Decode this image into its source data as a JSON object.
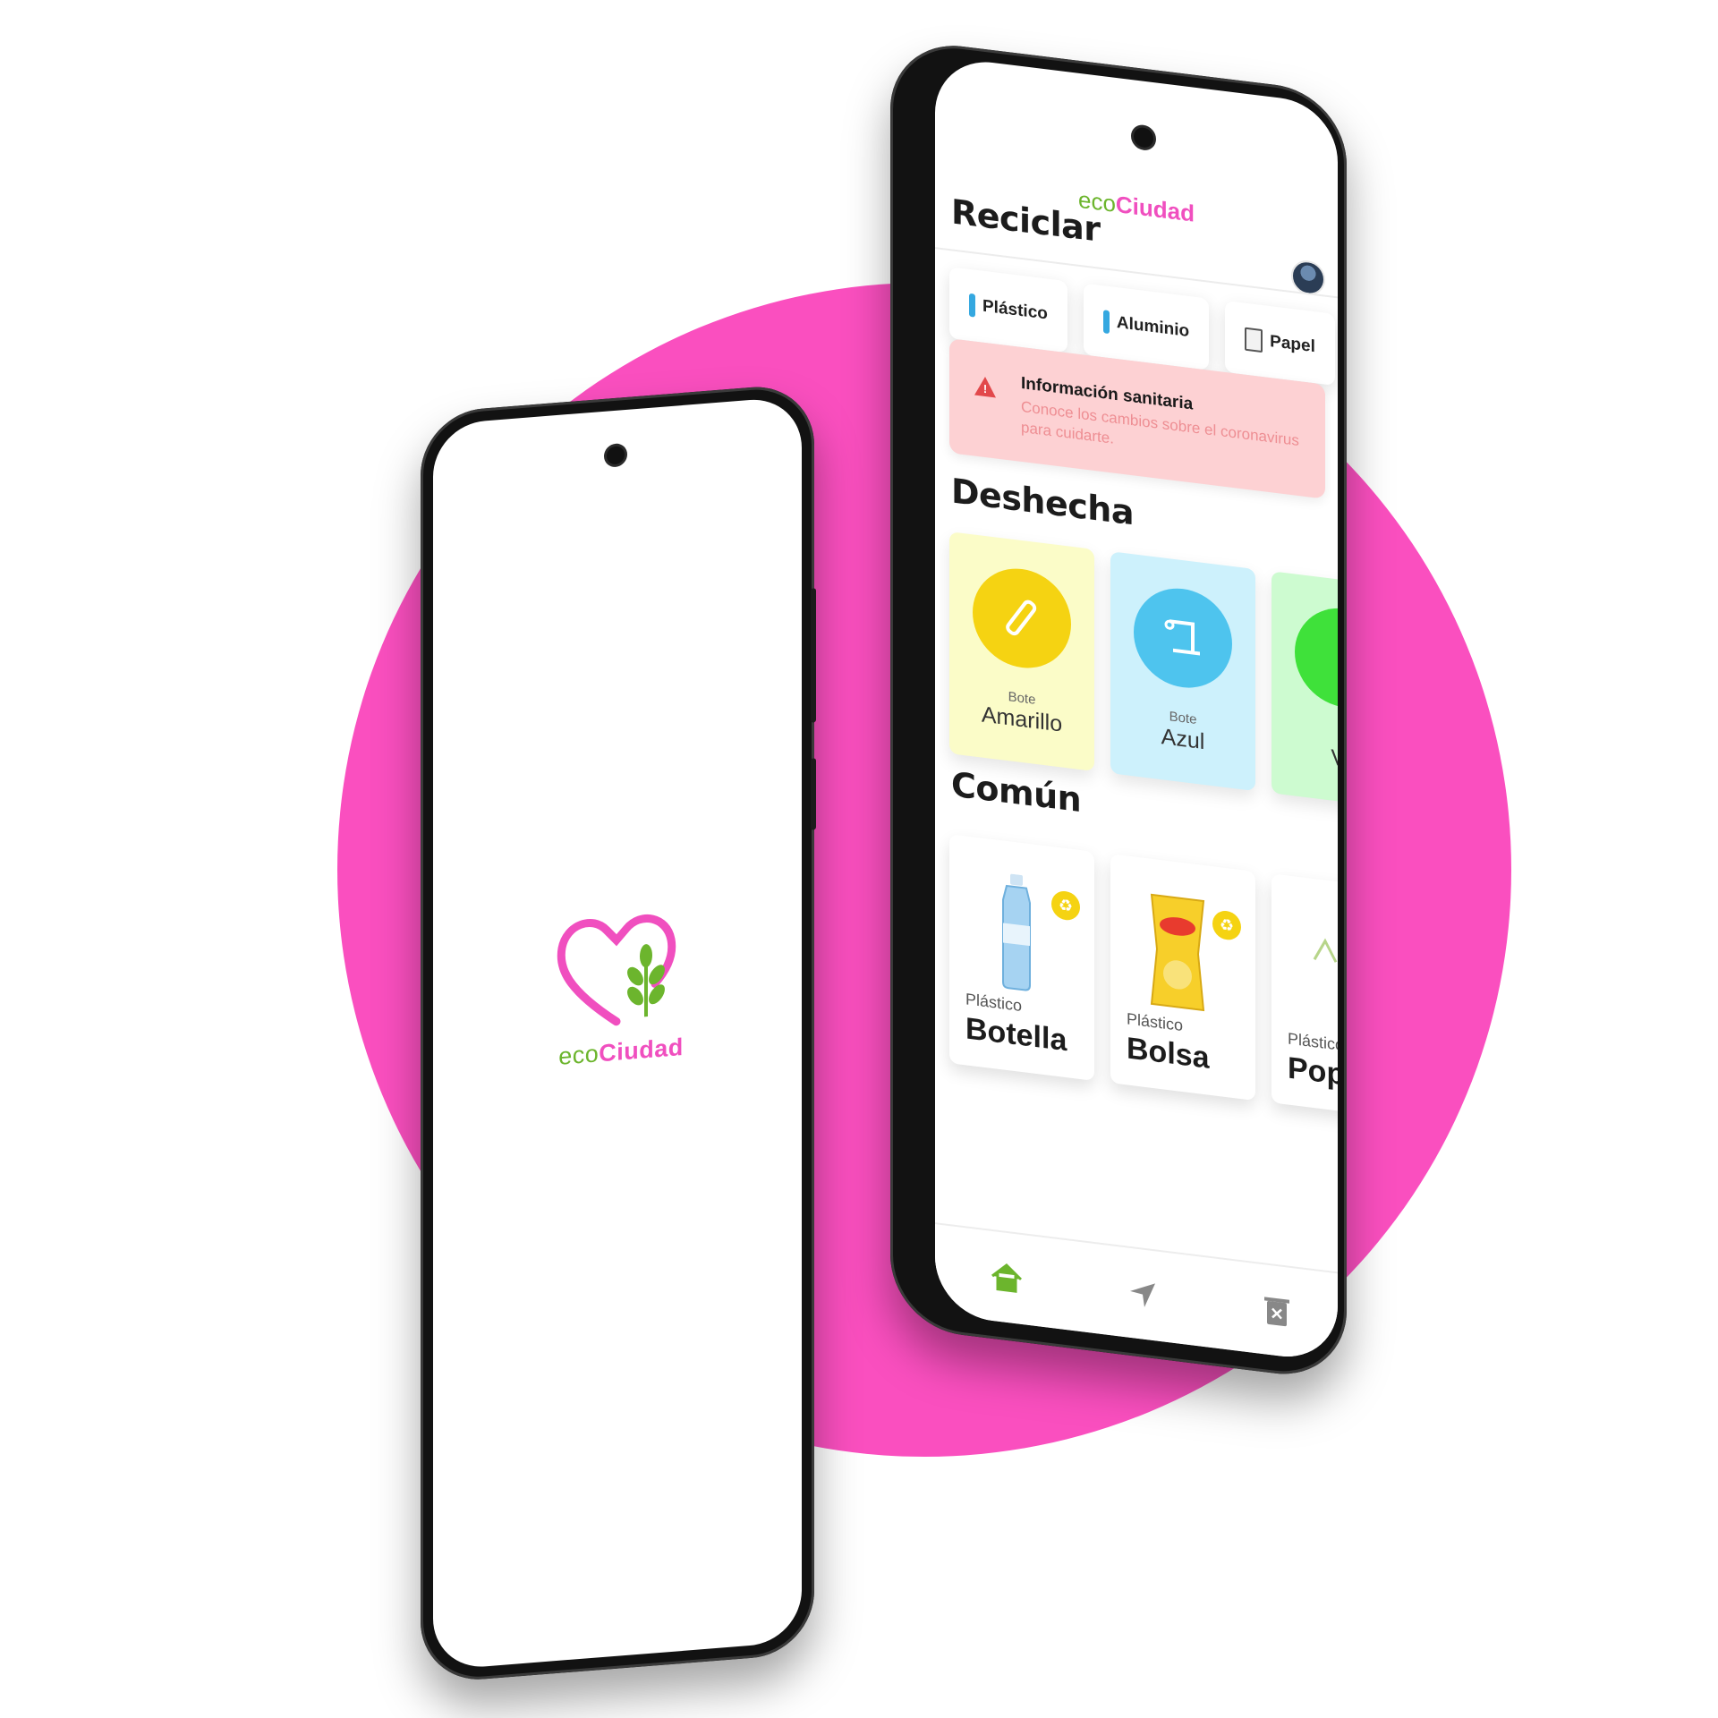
{
  "colors": {
    "brand_pink": "#fa4fbf",
    "brand_green": "#6cb52d",
    "alert_bg": "#fdd1d3",
    "bin_yellow": "#f5d312",
    "bin_blue": "#4ec4ee",
    "bin_green": "#3fe13a"
  },
  "splash": {
    "logo_icon": "heart-leaf-logo-icon",
    "brand_eco": "eco",
    "brand_ciudad": "Ciudad"
  },
  "app": {
    "header": {
      "brand_eco": "eco",
      "brand_ciudad": "Ciudad",
      "avatar_icon": "avatar"
    },
    "recycle": {
      "title": "Reciclar",
      "chips": [
        {
          "label": "Plástico",
          "icon": "bottle-icon"
        },
        {
          "label": "Aluminio",
          "icon": "can-icon"
        },
        {
          "label": "Papel",
          "icon": "paper-icon"
        }
      ]
    },
    "alert": {
      "icon": "warning-icon",
      "title": "Información sanitaria",
      "body": "Conoce los cambios sobre el coronavirus para cuidarte."
    },
    "dispose": {
      "title": "Deshecha",
      "bins": [
        {
          "small": "Bote",
          "name": "Amarillo",
          "icon": "bottle-icon"
        },
        {
          "small": "Bote",
          "name": "Azul",
          "icon": "paper-scroll-icon"
        },
        {
          "small": "B",
          "name": "Ve",
          "icon": ""
        }
      ]
    },
    "common": {
      "title": "Común",
      "items": [
        {
          "category": "Plástico",
          "name": "Botella",
          "icon": "water-bottle-image"
        },
        {
          "category": "Plástico",
          "name": "Bolsa",
          "icon": "chips-bag-image"
        },
        {
          "category": "Plástico",
          "name": "Pop",
          "icon": "popcorn-image"
        }
      ]
    },
    "nav": [
      {
        "icon": "home-icon",
        "active": true
      },
      {
        "icon": "location-arrow-icon",
        "active": false
      },
      {
        "icon": "trash-icon",
        "active": false
      }
    ]
  }
}
